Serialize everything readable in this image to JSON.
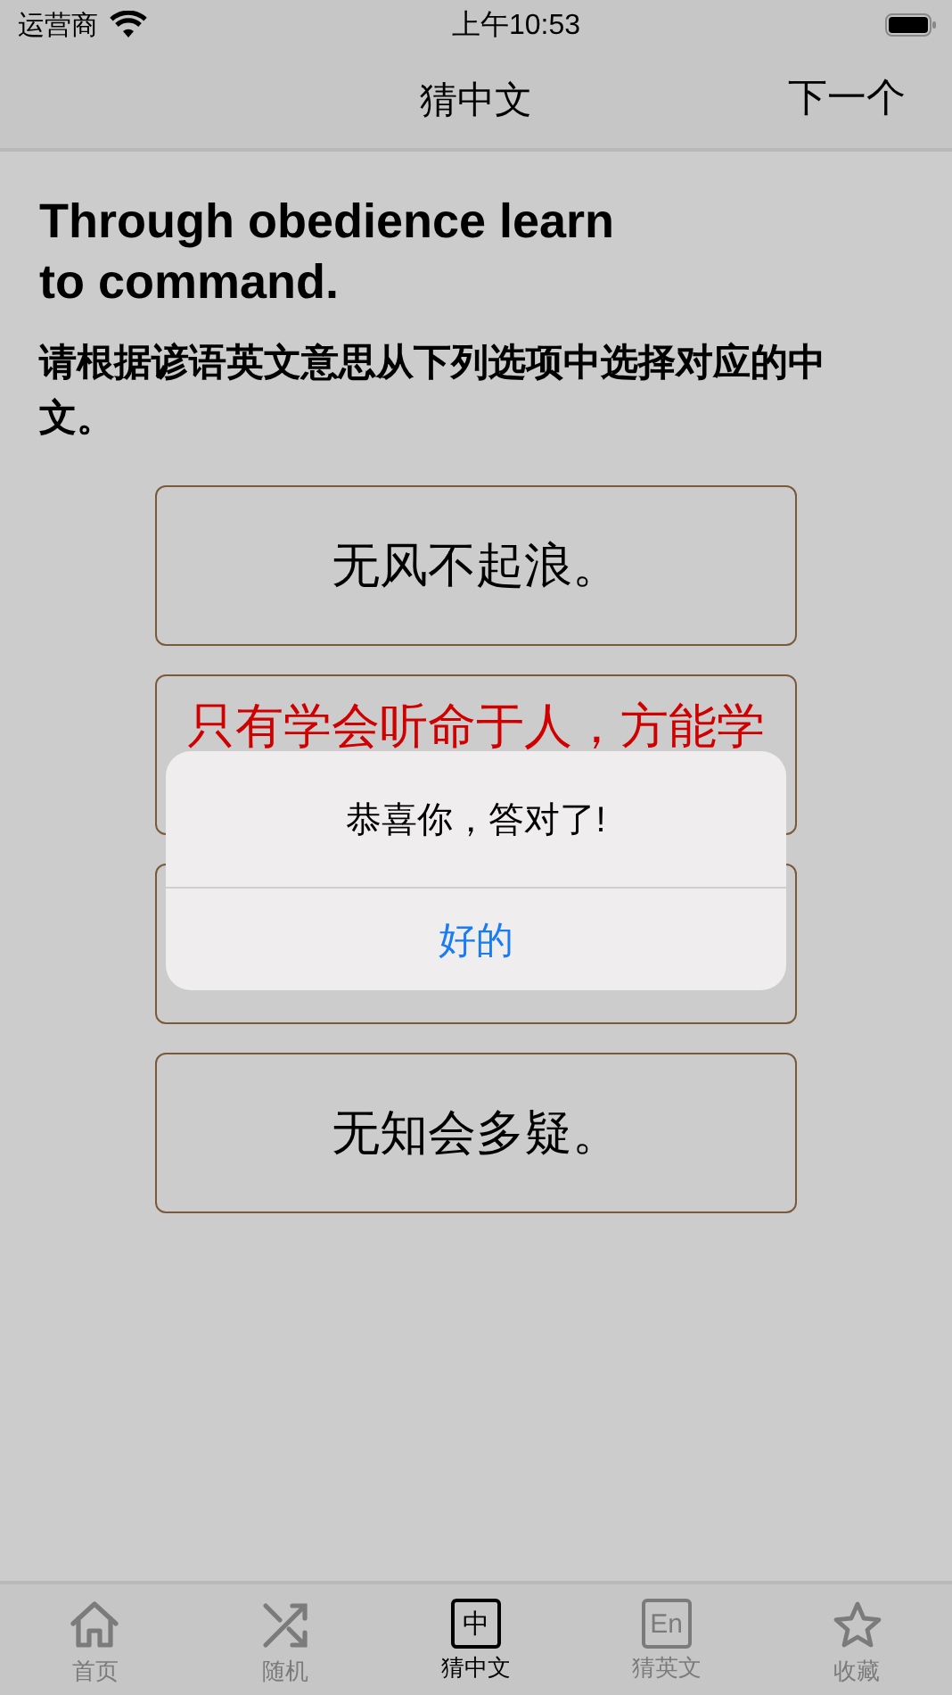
{
  "status_bar": {
    "carrier": "运营商",
    "time": "上午10:53"
  },
  "nav": {
    "title": "猜中文",
    "next": "下一个"
  },
  "question": {
    "english": "Through obedience learn to command.",
    "instruction": "请根据谚语英文意思从下列选项中选择对应的中文。"
  },
  "options": [
    {
      "kind": "text",
      "text": "无风不起浪。",
      "highlighted": false
    },
    {
      "kind": "text",
      "text": "只有学会听命于人，方能学",
      "highlighted": true
    },
    {
      "kind": "covered"
    },
    {
      "kind": "text",
      "text": "无知会多疑。",
      "highlighted": false
    }
  ],
  "alert": {
    "message": "恭喜你，答对了!",
    "button": "好的"
  },
  "tabs": [
    {
      "label": "首页",
      "kind": "home",
      "selected": false
    },
    {
      "label": "随机",
      "kind": "shuffle",
      "selected": false
    },
    {
      "label": "猜中文",
      "kind": "box",
      "glyph": "中",
      "selected": true
    },
    {
      "label": "猜英文",
      "kind": "box",
      "glyph": "En",
      "selected": false
    },
    {
      "label": "收藏",
      "kind": "star",
      "selected": false
    }
  ]
}
